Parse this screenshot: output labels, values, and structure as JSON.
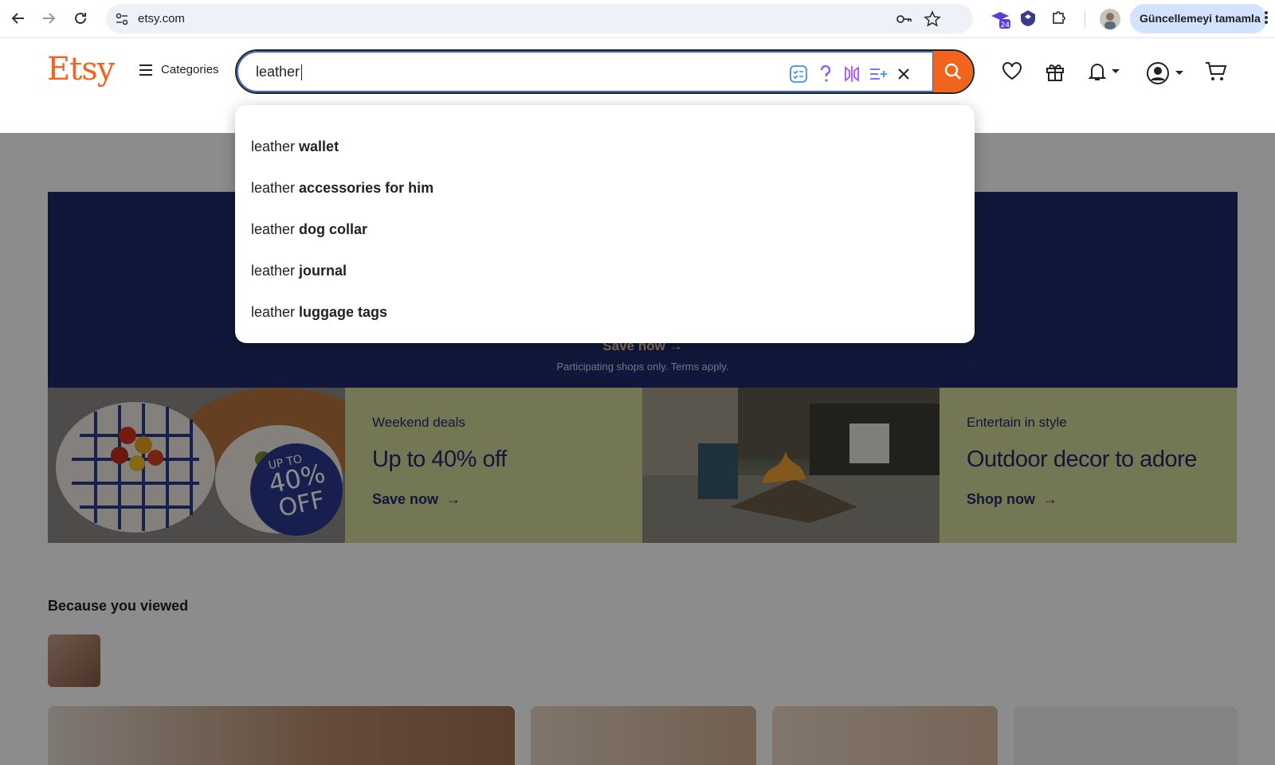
{
  "browser": {
    "url": "etsy.com",
    "update_button": "Güncellemeyi tamamla",
    "extension_badge": "24"
  },
  "header": {
    "logo": "Etsy",
    "categories_label": "Categories",
    "search": {
      "value": "leather"
    }
  },
  "suggestions": [
    {
      "prefix": "leather",
      "completion": "wallet"
    },
    {
      "prefix": "leather",
      "completion": "accessories for him"
    },
    {
      "prefix": "leather",
      "completion": "dog collar"
    },
    {
      "prefix": "leather",
      "completion": "journal"
    },
    {
      "prefix": "leather",
      "completion": "luggage tags"
    }
  ],
  "banner": {
    "cta": "Save now",
    "terms": "Participating shops only. Terms apply."
  },
  "tiles": [
    {
      "kicker": "Weekend deals",
      "headline": "Up to 40% off",
      "cta": "Save now"
    },
    {
      "kicker": "Entertain in style",
      "headline": "Outdoor decor to adore",
      "cta": "Shop now"
    }
  ],
  "plate_badge": {
    "line1": "UP TO",
    "line2": "40%",
    "line3": "OFF"
  },
  "because_you_viewed": {
    "title": "Because you viewed"
  },
  "colors": {
    "brand_orange": "#f1641e",
    "banner_navy": "#1e2a6b",
    "tile_green": "#d4d99a"
  }
}
